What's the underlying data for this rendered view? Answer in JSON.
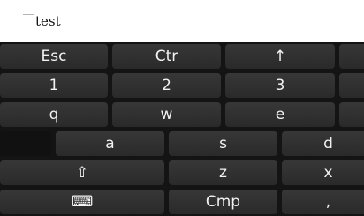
{
  "document": {
    "text": "test"
  },
  "keyboard": {
    "row1": {
      "esc": "Esc",
      "ctrl": "Ctr",
      "up": "↑"
    },
    "row2": {
      "k1": "1",
      "k2": "2",
      "k3": "3"
    },
    "row3": {
      "q": "q",
      "w": "w",
      "e": "e"
    },
    "row4": {
      "a": "a",
      "s": "s",
      "d": "d"
    },
    "row5": {
      "shift": "⇧",
      "z": "z",
      "x": "x"
    },
    "row6": {
      "keyboard_icon": "⌨",
      "compose": "Cmp",
      "comma": ","
    }
  }
}
